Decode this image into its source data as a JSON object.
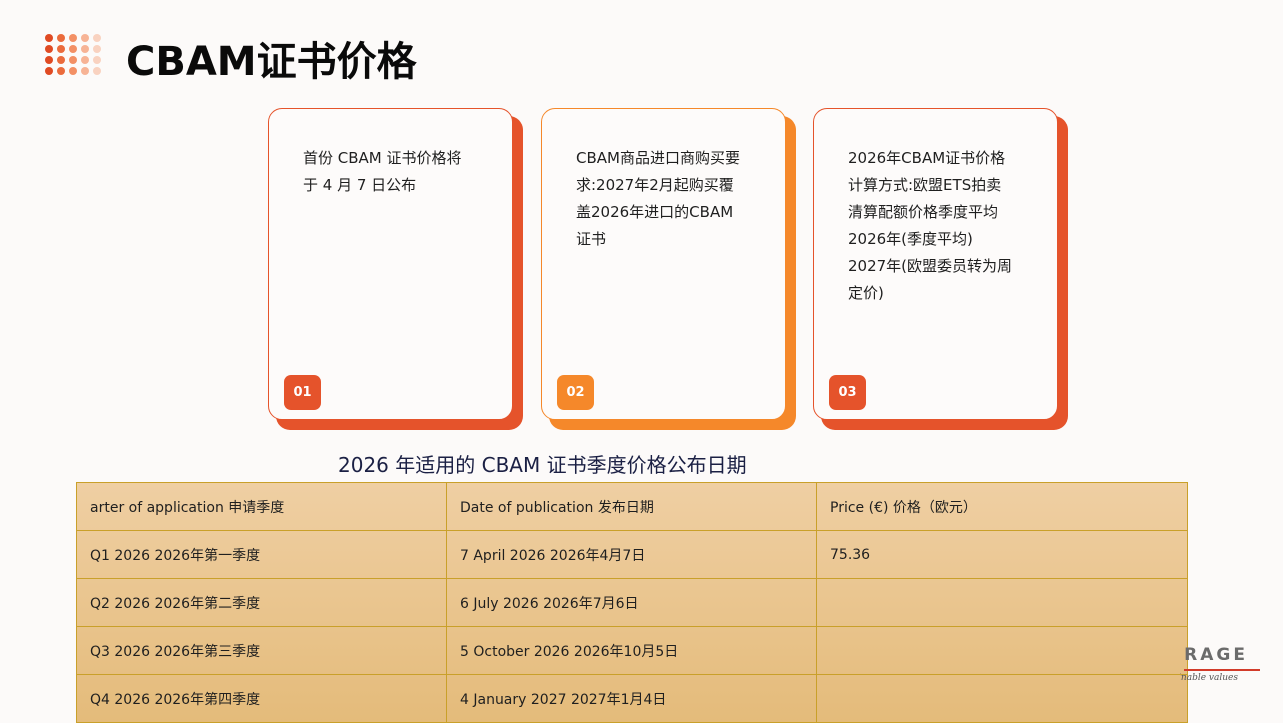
{
  "page": {
    "title": "CBAM证书价格"
  },
  "colors": {
    "accent_red": "#e5532b",
    "accent_orange": "#f5882a",
    "dot_palette": [
      "#e04a23",
      "#eb6b3c",
      "#f39065",
      "#f7b395",
      "#f9d2c0"
    ]
  },
  "cards": [
    {
      "text": "首份 CBAM 证书价格将\n于 4 月 7 日公布",
      "badge": "01",
      "color": "#e5532b",
      "shadow": "#e5532b"
    },
    {
      "text": "CBAM商品进口商购买要\n求:2027年2月起购买覆\n盖2026年进口的CBAM\n证书",
      "badge": "02",
      "color": "#f5882a",
      "shadow": "#f5882a"
    },
    {
      "text": "2026年CBAM证书价格\n计算方式:欧盟ETS拍卖\n清算配额价格季度平均\n2026年(季度平均)\n2027年(欧盟委员转为周\n定价)",
      "badge": "03",
      "color": "#e5532b",
      "shadow": "#e5532b"
    }
  ],
  "table": {
    "caption": "2026 年适用的 CBAM 证书季度价格公布日期",
    "headers": [
      "arter of application  申请季度",
      "Date of publication  发布日期",
      "Price (€)  价格（欧元）"
    ],
    "rows": [
      [
        "Q1 2026  2026年第一季度",
        "7 April 2026  2026年4月7日",
        "75.36"
      ],
      [
        "Q2 2026  2026年第二季度",
        "6 July 2026  2026年7月6日",
        ""
      ],
      [
        "Q3 2026  2026年第三季度",
        "5 October 2026  2026年10月5日",
        ""
      ],
      [
        "Q4 2026  2026年第四季度",
        "4 January 2027  2027年1月4日",
        ""
      ]
    ]
  },
  "logo": {
    "name": "ERAGE",
    "tagline": "stainable values"
  }
}
